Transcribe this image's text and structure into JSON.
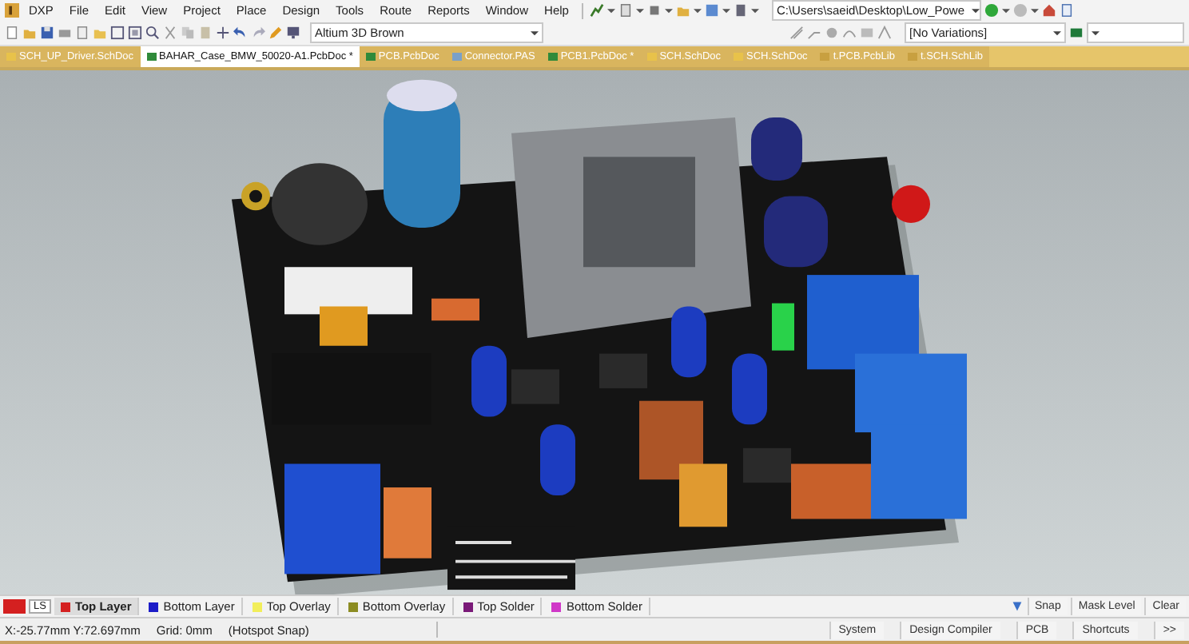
{
  "menu": [
    "DXP",
    "File",
    "Edit",
    "View",
    "Project",
    "Place",
    "Design",
    "Tools",
    "Route",
    "Reports",
    "Window",
    "Help"
  ],
  "path_field": {
    "value": "C:\\Users\\saeid\\Desktop\\Low_Powe"
  },
  "view_config": {
    "value": "Altium 3D Brown"
  },
  "variations": {
    "value": "[No Variations]"
  },
  "tabs": [
    {
      "label": "SCH_UP_Driver.SchDoc",
      "kind": "sch",
      "selected": false
    },
    {
      "label": "BAHAR_Case_BMW_50020-A1.PcbDoc *",
      "kind": "pcb",
      "selected": true
    },
    {
      "label": "PCB.PcbDoc",
      "kind": "pcb",
      "selected": false
    },
    {
      "label": "Connector.PAS",
      "kind": "script",
      "selected": false
    },
    {
      "label": "PCB1.PcbDoc *",
      "kind": "pcb",
      "selected": false
    },
    {
      "label": "SCH.SchDoc",
      "kind": "sch",
      "selected": false
    },
    {
      "label": "SCH.SchDoc",
      "kind": "sch",
      "selected": false
    },
    {
      "label": "t.PCB.PcbLib",
      "kind": "lib",
      "selected": false
    },
    {
      "label": "t.SCH.SchLib",
      "kind": "lib",
      "selected": false
    }
  ],
  "layer_bar": {
    "ls_label": "LS",
    "layers": [
      {
        "label": "Top Layer",
        "color": "#d42020",
        "selected": true
      },
      {
        "label": "Bottom Layer",
        "color": "#1c1cc8",
        "selected": false
      },
      {
        "label": "Top Overlay",
        "color": "#f2ee5a",
        "selected": false
      },
      {
        "label": "Bottom Overlay",
        "color": "#8c8c22",
        "selected": false
      },
      {
        "label": "Top Solder",
        "color": "#7a1a78",
        "selected": false
      },
      {
        "label": "Bottom Solder",
        "color": "#d038c8",
        "selected": false
      }
    ],
    "buttons": [
      "Snap",
      "Mask Level",
      "Clear"
    ]
  },
  "status_bar": {
    "coords": "X:-25.77mm Y:72.697mm",
    "grid": "Grid: 0mm",
    "snap": "(Hotspot Snap)",
    "panels": [
      "System",
      "Design Compiler",
      "PCB",
      "Shortcuts",
      ">>"
    ]
  }
}
